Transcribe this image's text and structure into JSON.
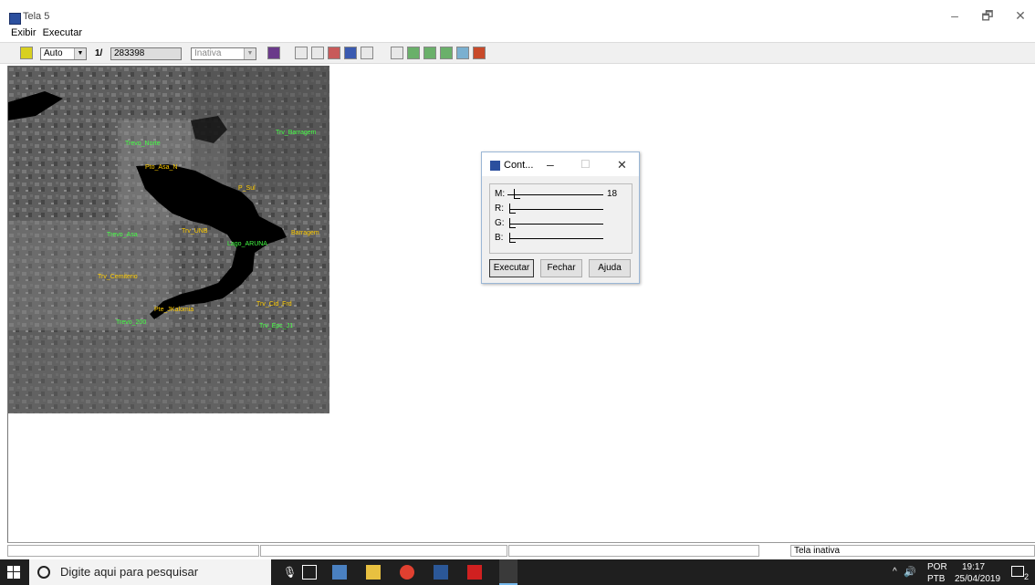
{
  "window": {
    "title": "Tela 5",
    "minimize": "–",
    "maximize": "🗗",
    "close": "✕"
  },
  "menu": [
    {
      "label": "Exibir"
    },
    {
      "label": "Executar"
    }
  ],
  "toolbar": {
    "mode_value": "Auto",
    "scale_prefix": "1/",
    "scale_value": "283398",
    "state_value": "Inativa"
  },
  "image_labels": [
    {
      "text": "Trevo_Norte",
      "color": "#44ff44"
    },
    {
      "text": "Trv_Barragem",
      "color": "#44ff44"
    },
    {
      "text": "Pto_Asa_N",
      "color": "#ffcc00"
    },
    {
      "text": "P_Sul",
      "color": "#ffcc00"
    },
    {
      "text": "Barragem",
      "color": "#ffcc00"
    },
    {
      "text": "Trevo_Asa",
      "color": "#44ff44"
    },
    {
      "text": "Trv_UNB",
      "color": "#ffcc00"
    },
    {
      "text": "Lago_ARUNA",
      "color": "#44ff44"
    },
    {
      "text": "Trv_Cemiterio",
      "color": "#ffcc00"
    },
    {
      "text": "Trv_Cid_Frd",
      "color": "#ffcc00"
    },
    {
      "text": "Pte_JKalomia",
      "color": "#ffcc00"
    },
    {
      "text": "Trevo_200",
      "color": "#44ff44"
    },
    {
      "text": "Trv_Epc_J1",
      "color": "#44ff44"
    }
  ],
  "dialog": {
    "title": "Cont...",
    "sliders": [
      {
        "label": "M:",
        "value": "18",
        "level": 0.05
      },
      {
        "label": "R:",
        "value": "",
        "level": 0
      },
      {
        "label": "G:",
        "value": "",
        "level": 0
      },
      {
        "label": "B:",
        "value": "",
        "level": 0
      }
    ],
    "buttons": {
      "run": "Executar",
      "close": "Fechar",
      "help": "Ajuda"
    }
  },
  "statusbar": {
    "status_text": "Tela inativa"
  },
  "taskbar": {
    "search_placeholder": "Digite aqui para pesquisar",
    "language_top": "POR",
    "language_bottom": "PTB",
    "time": "19:17",
    "date": "25/04/2019",
    "notification_count": "2"
  }
}
